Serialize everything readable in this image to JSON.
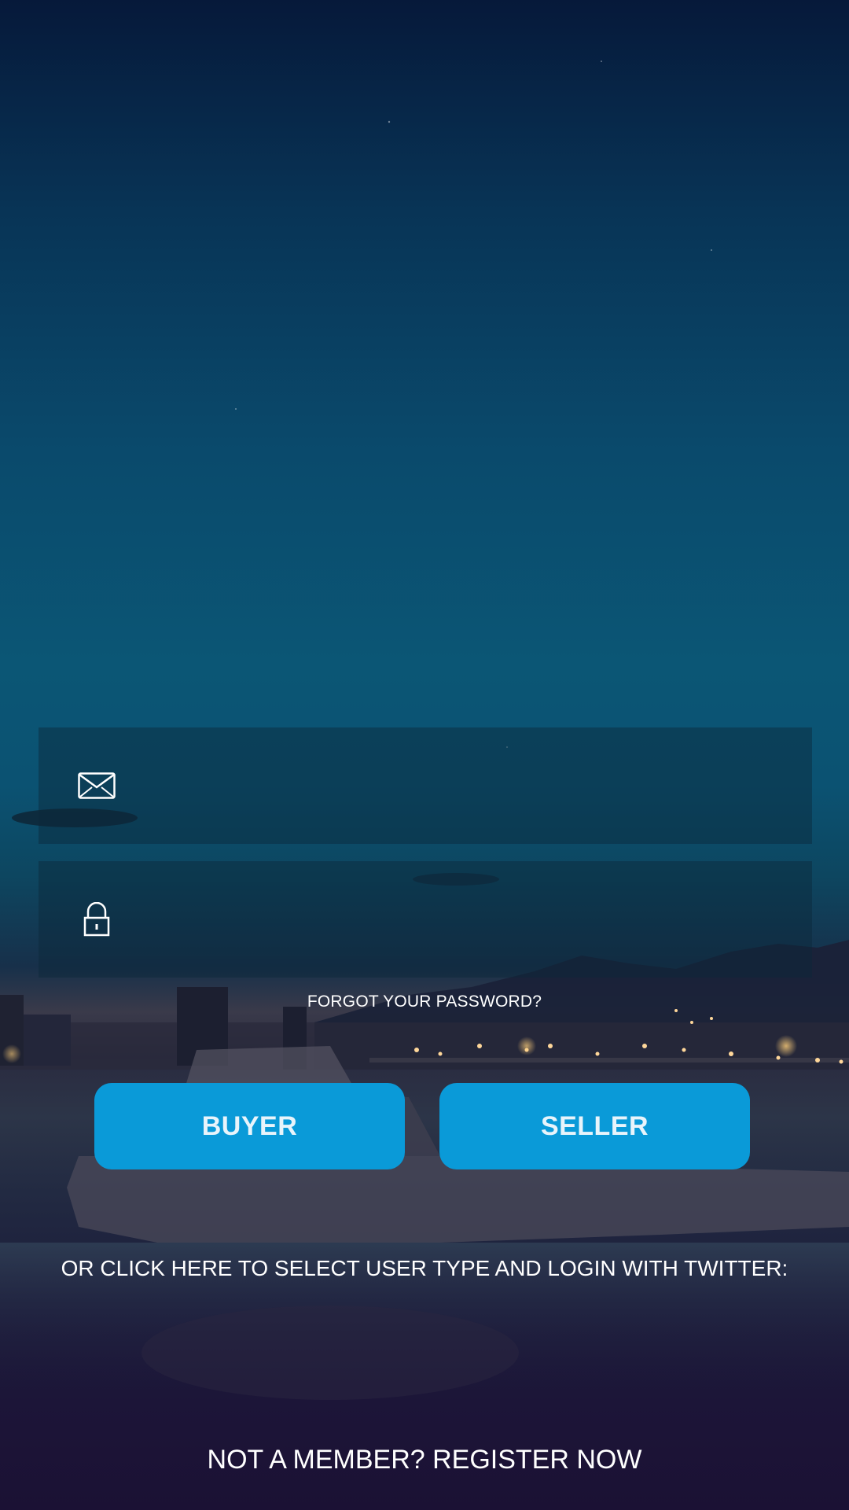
{
  "login_form": {
    "email": {
      "value": "",
      "placeholder": "",
      "icon": "envelope-icon"
    },
    "password": {
      "value": "",
      "placeholder": "",
      "icon": "lock-icon"
    },
    "forgot_password_label": "FORGOT YOUR PASSWORD?"
  },
  "user_type_buttons": {
    "buyer_label": "BUYER",
    "seller_label": "SELLER",
    "button_color": "#0a9ad8"
  },
  "twitter_login_label": "OR CLICK HERE TO SELECT USER TYPE AND LOGIN WITH TWITTER:",
  "register_label": "NOT A MEMBER? REGISTER NOW",
  "colors": {
    "text": "#ffffff",
    "field_background": "rgba(12, 40, 58, 0.45)",
    "sky_top": "#06193a",
    "sky_mid": "#0b5675",
    "bottom": "#1b1134"
  }
}
